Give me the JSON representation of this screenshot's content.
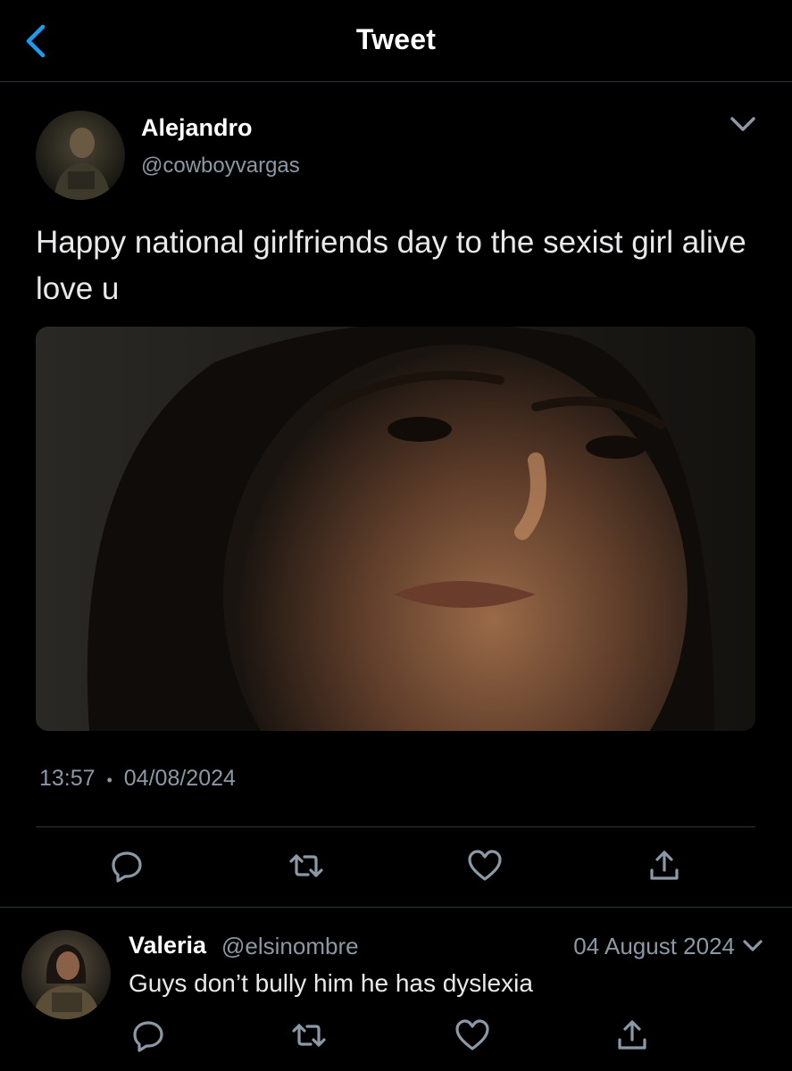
{
  "header": {
    "title": "Tweet",
    "back_icon": "chevron-left-icon"
  },
  "tweet": {
    "author_name": "Alejandro",
    "author_handle": "@cowboyvargas",
    "text": "Happy national girlfriends day to the sexist girl alive love u",
    "time": "13:57",
    "separator": "•",
    "date": "04/08/2024",
    "actions": [
      "reply-icon",
      "retweet-icon",
      "like-icon",
      "share-icon"
    ]
  },
  "reply": {
    "author_name": "Valeria",
    "author_handle": "@elsinombre",
    "date": "04 August 2024",
    "text": "Guys don’t bully him he has dyslexia",
    "actions": [
      "reply-icon",
      "retweet-icon",
      "like-icon",
      "share-icon"
    ]
  },
  "colors": {
    "accent": "#1d9bf0",
    "muted": "#8b98a5",
    "icon": "#8b98a5",
    "background": "#000000",
    "divider": "#2f3336"
  }
}
